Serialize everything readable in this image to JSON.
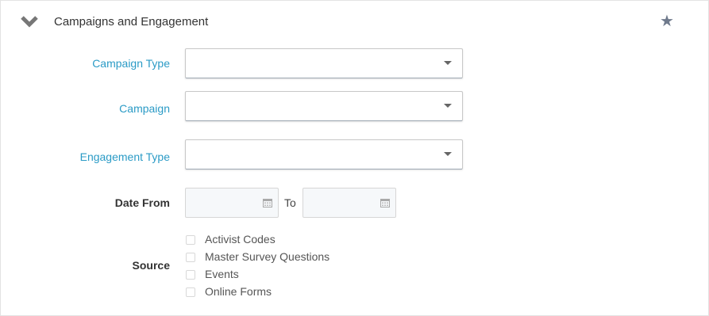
{
  "panel": {
    "title": "Campaigns and Engagement",
    "icons": {
      "collapse": "chevron-down-icon",
      "favorite": "star-icon"
    }
  },
  "fields": {
    "campaign_type": {
      "label": "Campaign Type",
      "value": ""
    },
    "campaign": {
      "label": "Campaign",
      "value": ""
    },
    "engagement_type": {
      "label": "Engagement Type",
      "value": ""
    },
    "date_from": {
      "label": "Date From",
      "value": "",
      "to_label": "To",
      "to_value": ""
    },
    "source": {
      "label": "Source",
      "options": [
        {
          "label": "Activist Codes",
          "checked": false
        },
        {
          "label": "Master Survey Questions",
          "checked": false
        },
        {
          "label": "Events",
          "checked": false
        },
        {
          "label": "Online Forms",
          "checked": false
        }
      ]
    }
  },
  "colors": {
    "link_label": "#2b9bc6",
    "star": "#6f7a8c",
    "chevron": "#777777"
  }
}
